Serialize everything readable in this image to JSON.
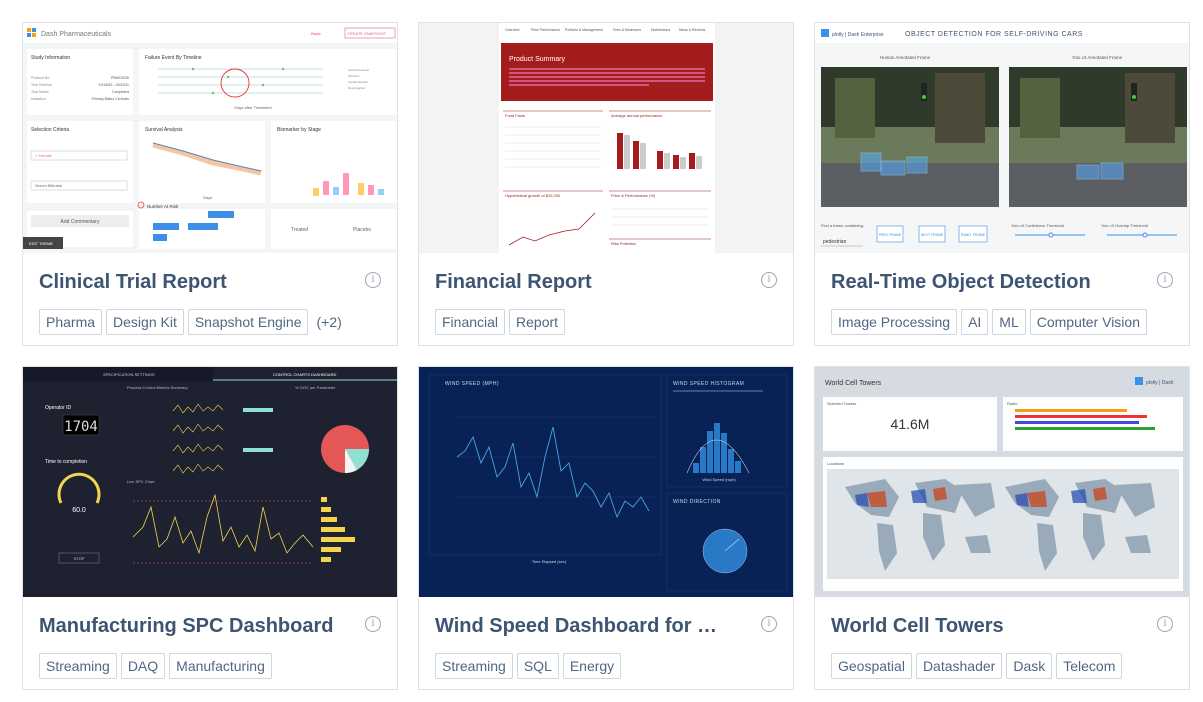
{
  "cards": [
    {
      "title": "Clinical Trial Report",
      "tags": [
        "Pharma",
        "Design Kit",
        "Snapshot Engine"
      ],
      "more": "(+2)",
      "thumb": {
        "brand": "Dash Pharmaceuticals",
        "study": "Study Information",
        "failure": "Failure Event By Timeline",
        "xlabel": "Days after Treatment",
        "criteria": "Selection Criteria",
        "survival": "Survival Analysis",
        "biomarker": "Biomarker by Stage",
        "commentary": "Add Commentary",
        "number": "Number At Risk",
        "edit": "EDIT THEME",
        "create": "CREATE SNAPSHOT"
      }
    },
    {
      "title": "Financial Report",
      "tags": [
        "Financial",
        "Report"
      ],
      "thumb": {
        "nav": [
          "Overview",
          "Price Performance",
          "Portfolio & Management",
          "Fees & Minimums",
          "Distributions",
          "News & Reviews"
        ],
        "summary": "Product Summary",
        "fund": "Fund Facts",
        "perf": "Average annual performance",
        "growth": "Hypothetical growth of $10,000",
        "price": "Price & Performance (%)",
        "risk": "Risk Potential"
      }
    },
    {
      "title": "Real-Time Object Detection",
      "tags": [
        "Image Processing",
        "AI",
        "ML",
        "Computer Vision"
      ],
      "thumb": {
        "brand": "plotly | Dash Enterprise",
        "heading": "OBJECT DETECTION FOR SELF-DRIVING CARS",
        "left": "Human Annotated Frame",
        "right": "Yolo v3 Annotated Frame",
        "find": "Find a frame containing:",
        "value": "pedestrian",
        "prev": "PREV FRAME",
        "next": "NEXT FRAME",
        "random": "RAND. FRAME",
        "conf": "Yolo v3 Confidence Threshold",
        "overlap": "Yolo v3 Overlap Threshold"
      }
    },
    {
      "title": "Manufacturing SPC Dashboard",
      "tags": [
        "Streaming",
        "DAQ",
        "Manufacturing"
      ],
      "thumb": {
        "tab1": "SPECIFICATION SETTINGS",
        "tab2": "CONTROL CHARTS DASHBOARD",
        "operator": "Operator ID",
        "digits": "1704",
        "time": "Time to completion",
        "gauge": "60.0",
        "stop": "STOP",
        "metrics": "Process Control Metrics Summary",
        "ooc": "% OOC per Parameter",
        "live": "Live SPC Chart"
      }
    },
    {
      "title": "Wind Speed Dashboard for …",
      "tags": [
        "Streaming",
        "SQL",
        "Energy"
      ],
      "thumb": {
        "speed": "WIND SPEED (MPH)",
        "hist": "WIND SPEED HISTOGRAM",
        "dir": "WIND DIRECTION",
        "xlabel": "Time Elapsed (sec)",
        "hx": "Wind Speed (mph)"
      }
    },
    {
      "title": "World Cell Towers",
      "tags": [
        "Geospatial",
        "Datashader",
        "Dask",
        "Telecom"
      ],
      "thumb": {
        "heading": "World Cell Towers",
        "brand": "plotly | Dash",
        "selected": "Selected Towers",
        "count": "41.6M",
        "radio": "Radio",
        "locations": "Locations"
      }
    }
  ],
  "info_glyph": "i",
  "colors": {
    "title": "#3d5473",
    "tag_text": "#506784",
    "border": "#dfe3e8",
    "finance_red": "#a51c1c",
    "spc_bg": "#1e2130",
    "wind_bg": "#082255",
    "yellow": "#f4d44d"
  }
}
